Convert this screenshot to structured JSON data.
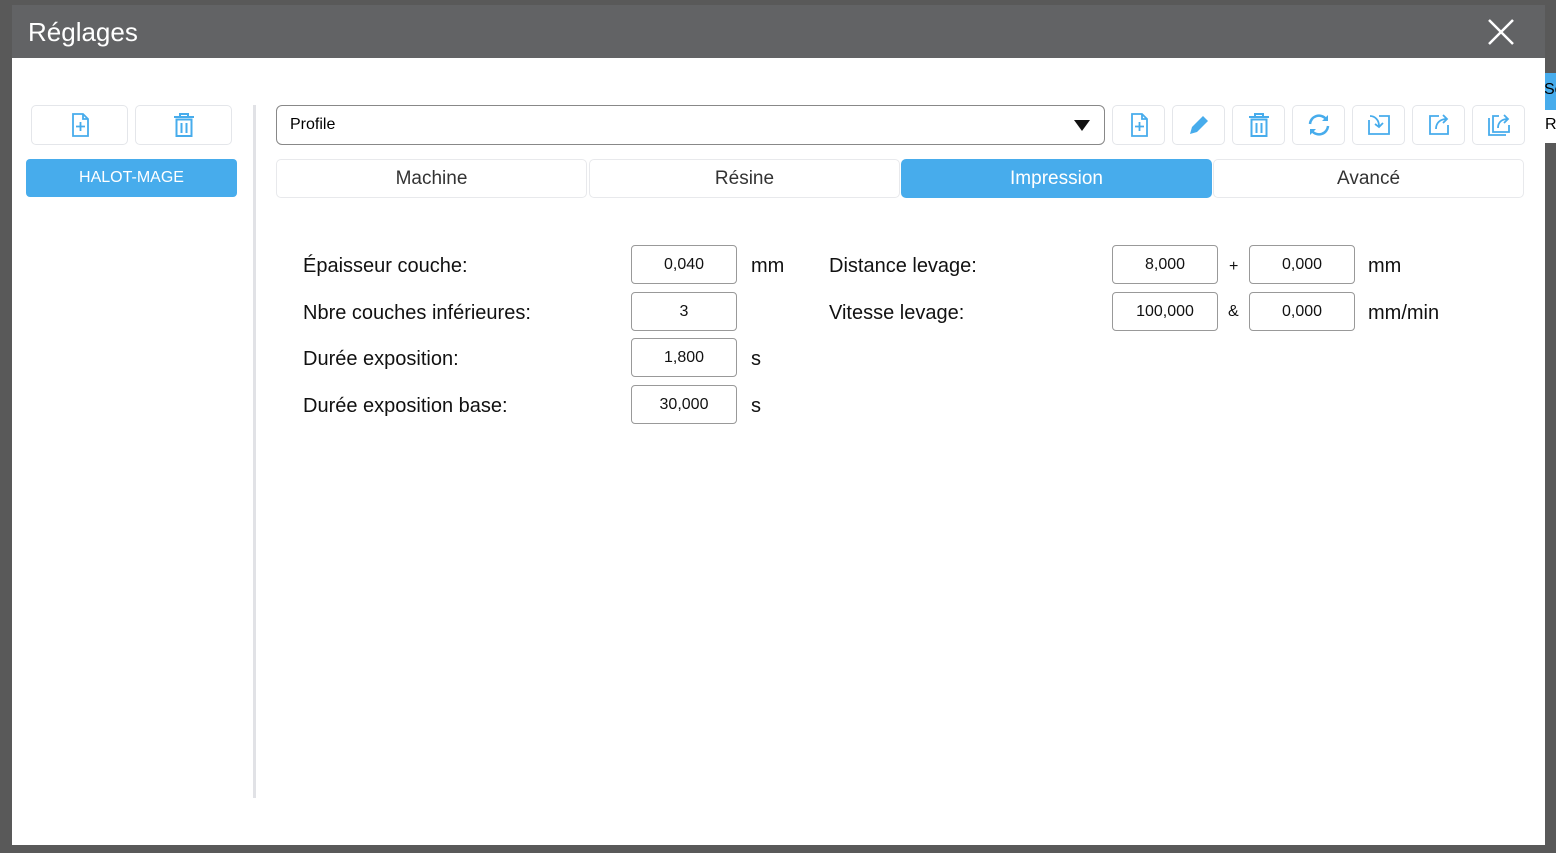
{
  "window": {
    "title": "Réglages"
  },
  "sidebar": {
    "profiles": [
      {
        "label": "HALOT-MAGE",
        "selected": true
      }
    ]
  },
  "profile_select": {
    "value": "Profile"
  },
  "toolbar_icons": [
    "file-add-icon",
    "pencil-icon",
    "trash-icon",
    "refresh-icon",
    "import-icon",
    "export-icon",
    "export-copy-icon"
  ],
  "tabs": [
    {
      "label": "Machine"
    },
    {
      "label": "Résine"
    },
    {
      "label": "Impression",
      "active": true
    },
    {
      "label": "Avancé"
    }
  ],
  "form": {
    "layer_thickness": {
      "label": "Épaisseur couche:",
      "value": "0,040",
      "unit": "mm"
    },
    "bottom_layers": {
      "label": "Nbre couches inférieures:",
      "value": "3"
    },
    "exposure": {
      "label": "Durée exposition:",
      "value": "1,800",
      "unit": "s"
    },
    "bottom_exposure": {
      "label": "Durée exposition base:",
      "value": "30,000",
      "unit": "s"
    },
    "lift_distance": {
      "label": "Distance levage:",
      "value1": "8,000",
      "sep": "+",
      "value2": "0,000",
      "unit": "mm"
    },
    "lift_speed": {
      "label": "Vitesse levage:",
      "value1": "100,000",
      "sep": "&",
      "value2": "0,000",
      "unit": "mm/min"
    }
  },
  "background": {
    "fragment1": "Sc",
    "fragment2": "Ra"
  },
  "colors": {
    "accent": "#47acec",
    "titlebar": "#626365"
  }
}
